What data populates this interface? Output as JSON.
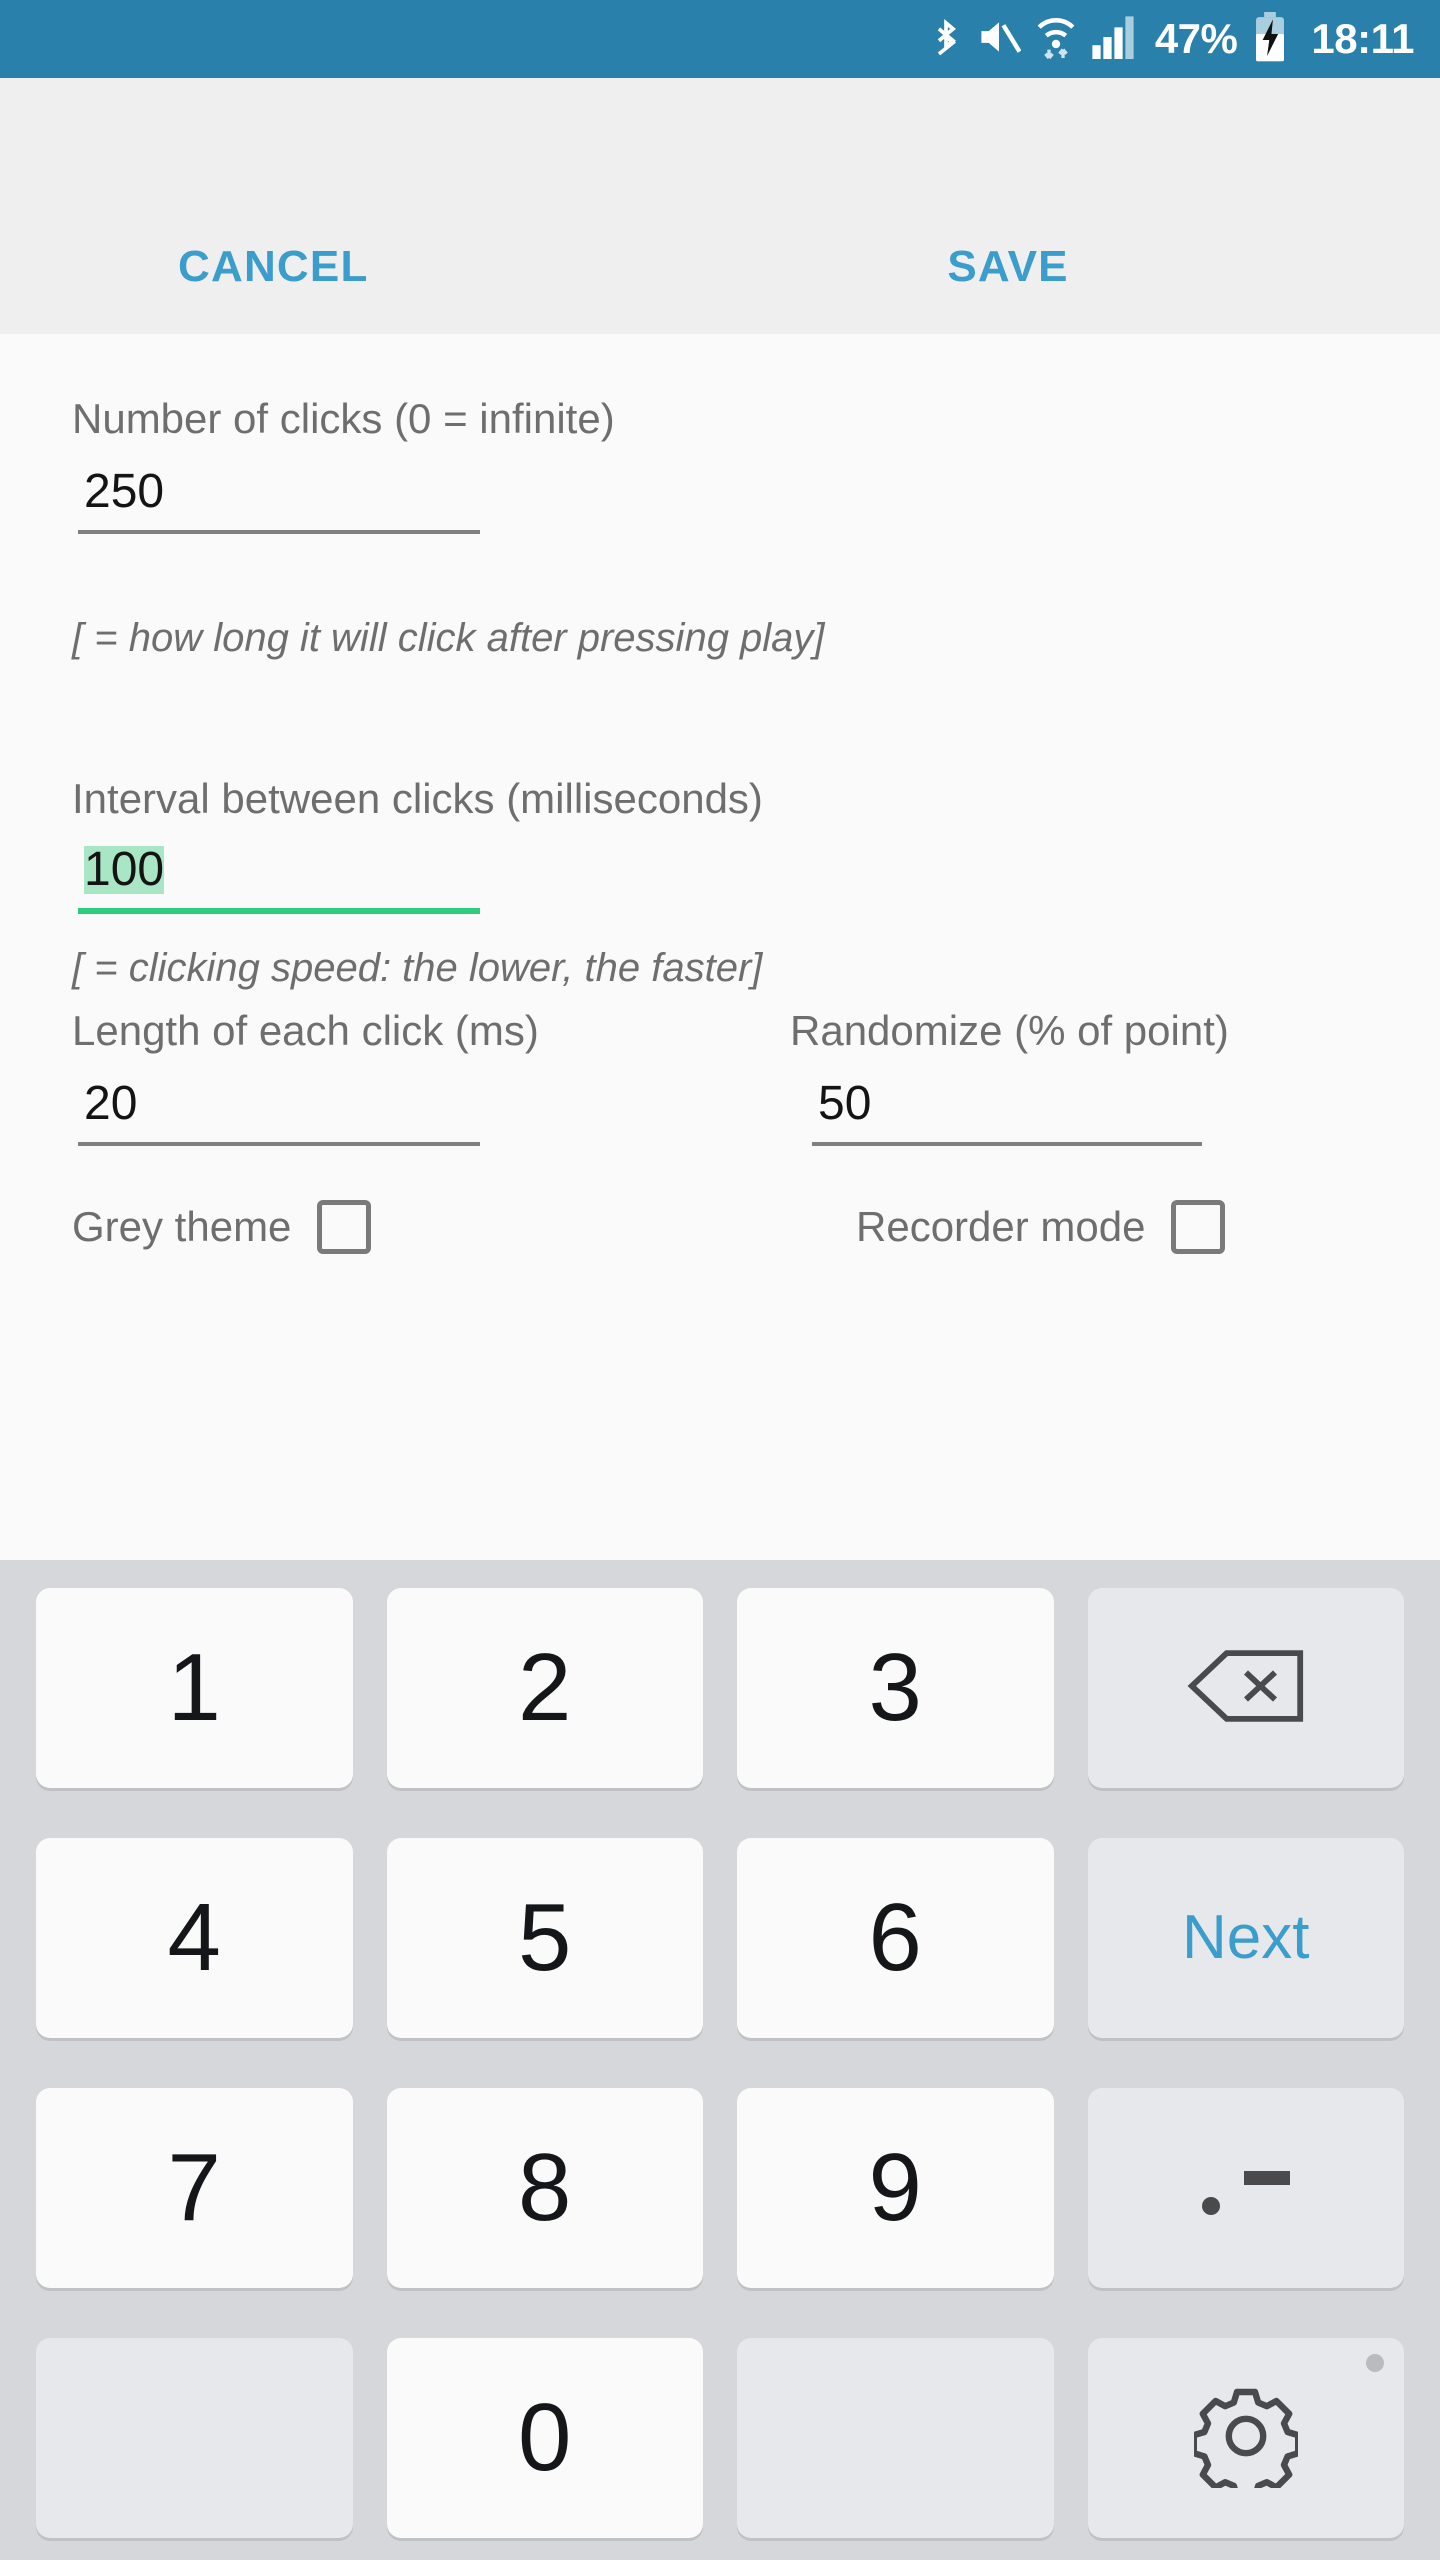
{
  "statusbar": {
    "icons": [
      "bluetooth-icon",
      "mute-icon",
      "wifi-icon",
      "signal-icon",
      "battery-charging-icon"
    ],
    "battery_percent": "47%",
    "clock": "18:11",
    "background_color": "#2980ab"
  },
  "actionbar": {
    "cancel_label": "CANCEL",
    "save_label": "SAVE",
    "accent_color": "#3b9dcc",
    "background_color": "#efeff0"
  },
  "form": {
    "clicks": {
      "label": "Number of clicks (0 = infinite)",
      "value": "250",
      "hint": "[ = how long it will click after pressing play]"
    },
    "interval": {
      "label": "Interval between clicks (milliseconds)",
      "value": "100",
      "hint": "[ = clicking speed: the lower, the faster]",
      "active": true,
      "selection_color": "#a9e6c6",
      "underline_color": "#2ecc80"
    },
    "click_length": {
      "label": "Length of each click (ms)",
      "value": "20"
    },
    "randomize": {
      "label": "Randomize (% of point)",
      "value": "50"
    },
    "grey_theme": {
      "label": "Grey theme",
      "checked": false
    },
    "recorder_mode": {
      "label": "Recorder mode",
      "checked": false
    }
  },
  "keyboard": {
    "background_color": "#d6d7db",
    "rows": [
      [
        {
          "name": "key-1",
          "label": "1",
          "type": "num"
        },
        {
          "name": "key-2",
          "label": "2",
          "type": "num"
        },
        {
          "name": "key-3",
          "label": "3",
          "type": "num"
        },
        {
          "name": "key-backspace",
          "label": "",
          "type": "fn",
          "icon": "backspace-icon"
        }
      ],
      [
        {
          "name": "key-4",
          "label": "4",
          "type": "num"
        },
        {
          "name": "key-5",
          "label": "5",
          "type": "num"
        },
        {
          "name": "key-6",
          "label": "6",
          "type": "num"
        },
        {
          "name": "key-next",
          "label": "Next",
          "type": "fn",
          "icon": "text"
        }
      ],
      [
        {
          "name": "key-7",
          "label": "7",
          "type": "num"
        },
        {
          "name": "key-8",
          "label": "8",
          "type": "num"
        },
        {
          "name": "key-9",
          "label": "9",
          "type": "num"
        },
        {
          "name": "key-dot-dash",
          "label": ".-",
          "type": "fn",
          "icon": "dot-dash-icon"
        }
      ],
      [
        {
          "name": "key-blank-left",
          "label": "",
          "type": "blank"
        },
        {
          "name": "key-0",
          "label": "0",
          "type": "num"
        },
        {
          "name": "key-blank-right",
          "label": "",
          "type": "blank"
        },
        {
          "name": "key-settings",
          "label": "",
          "type": "fn",
          "icon": "gear-icon",
          "badge": true
        }
      ]
    ]
  }
}
